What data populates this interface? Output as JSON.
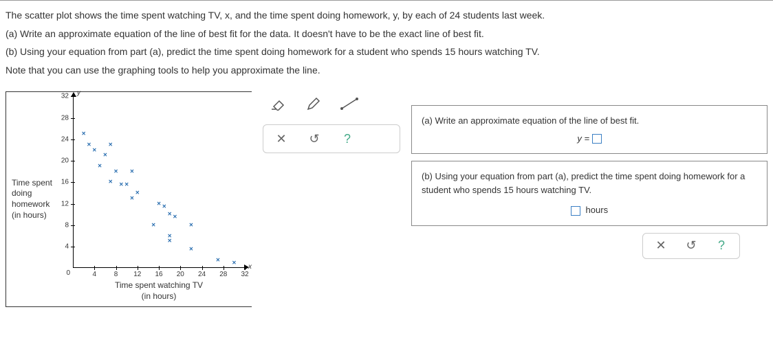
{
  "problem": {
    "intro": "The scatter plot shows the time spent watching TV, x, and the time spent doing homework, y, by each of 24 students last week.",
    "part_a": "(a) Write an approximate equation of the line of best fit for the data. It doesn't have to be the exact line of best fit.",
    "part_b": "(b) Using your equation from part (a), predict the time spent doing homework for a student who spends 15 hours watching TV.",
    "note": "Note that you can use the graphing tools to help you approximate the line."
  },
  "chart_data": {
    "type": "scatter",
    "xlabel_top": "Time spent watching TV",
    "xlabel_bot": "(in hours)",
    "ylabel_a": "Time spent",
    "ylabel_b": "doing homework",
    "ylabel_c": "(in hours)",
    "x_axis_var": "x",
    "y_axis_var": "y",
    "xlim": [
      0,
      32
    ],
    "ylim": [
      0,
      32
    ],
    "ticks": [
      4,
      8,
      12,
      16,
      20,
      24,
      28,
      32
    ],
    "origin": "0",
    "points": [
      {
        "x": 2,
        "y": 25
      },
      {
        "x": 3,
        "y": 23
      },
      {
        "x": 4,
        "y": 22
      },
      {
        "x": 6,
        "y": 21
      },
      {
        "x": 7,
        "y": 23
      },
      {
        "x": 5,
        "y": 19
      },
      {
        "x": 8,
        "y": 18
      },
      {
        "x": 7,
        "y": 16
      },
      {
        "x": 9,
        "y": 15.5
      },
      {
        "x": 10,
        "y": 15.5
      },
      {
        "x": 11,
        "y": 18
      },
      {
        "x": 11,
        "y": 13
      },
      {
        "x": 12,
        "y": 14
      },
      {
        "x": 16,
        "y": 12
      },
      {
        "x": 17,
        "y": 11.5
      },
      {
        "x": 18,
        "y": 10
      },
      {
        "x": 15,
        "y": 8
      },
      {
        "x": 19,
        "y": 9.5
      },
      {
        "x": 18,
        "y": 6
      },
      {
        "x": 18,
        "y": 5
      },
      {
        "x": 22,
        "y": 8
      },
      {
        "x": 22,
        "y": 3.5
      },
      {
        "x": 27,
        "y": 1.5
      },
      {
        "x": 30,
        "y": 1
      }
    ],
    "origin_label": "0",
    "tick4": "4",
    "tick8": "8",
    "tick12": "12",
    "tick16": "16",
    "tick20": "20",
    "tick24": "24",
    "tick28": "28",
    "tick32": "32"
  },
  "toolbar": {
    "clear": "✕",
    "reset": "↺",
    "help": "?"
  },
  "answer_a": {
    "prompt": "(a) Write an approximate equation of the line of best fit.",
    "eq_left": "y ="
  },
  "answer_b": {
    "prompt": "(b) Using your equation from part (a), predict the time spent doing homework for a student who spends 15 hours watching TV.",
    "unit": "hours"
  }
}
